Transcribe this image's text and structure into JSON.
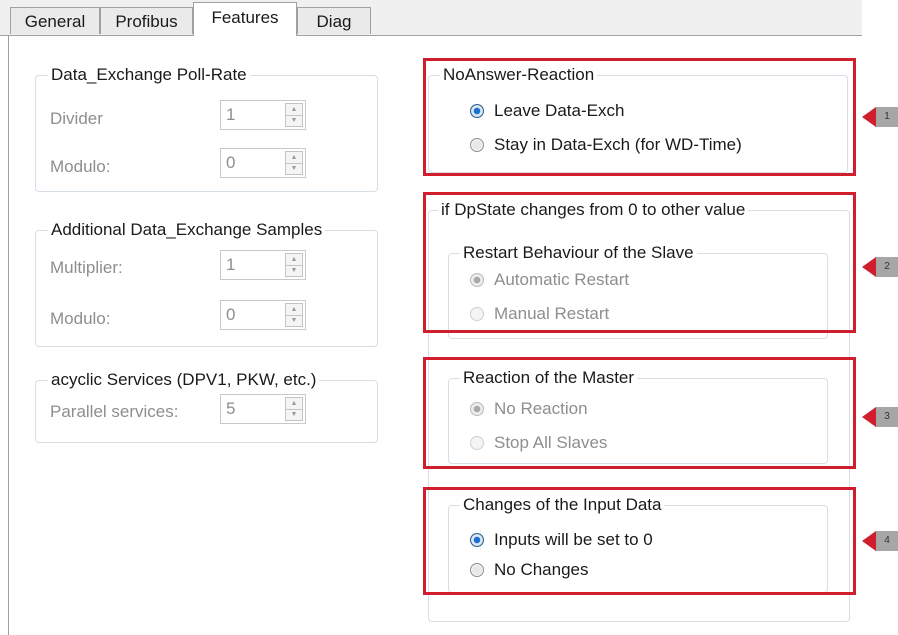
{
  "tabs": [
    "General",
    "Profibus",
    "Features",
    "Diag"
  ],
  "poll_rate": {
    "title": "Data_Exchange Poll-Rate",
    "divider_label": "Divider",
    "divider_value": "1",
    "modulo_label": "Modulo:",
    "modulo_value": "0"
  },
  "additional_samples": {
    "title": "Additional Data_Exchange Samples",
    "multiplier_label": "Multiplier:",
    "multiplier_value": "1",
    "modulo_label": "Modulo:",
    "modulo_value": "0"
  },
  "acyclic": {
    "title": "acyclic Services (DPV1, PKW, etc.)",
    "parallel_label": "Parallel services:",
    "parallel_value": "5"
  },
  "no_answer": {
    "title": "NoAnswer-Reaction",
    "options": [
      "Leave Data-Exch",
      "Stay in Data-Exch (for WD-Time)"
    ],
    "selected": "Leave Data-Exch"
  },
  "dpstate": {
    "title": "if DpState changes from 0 to other value",
    "restart": {
      "title": "Restart Behaviour of the Slave",
      "options": [
        "Automatic Restart",
        "Manual Restart"
      ],
      "selected": "Automatic Restart"
    },
    "master": {
      "title": "Reaction of the Master",
      "options": [
        "No Reaction",
        "Stop All Slaves"
      ],
      "selected": "No Reaction"
    },
    "inputs": {
      "title": "Changes of the Input Data",
      "options": [
        "Inputs will be set to 0",
        "No Changes"
      ],
      "selected": "Inputs will be set to 0"
    }
  },
  "markers": [
    "1",
    "2",
    "3",
    "4"
  ],
  "colors": {
    "highlight": "#d01e2e",
    "marker_box": "#a6a6a6",
    "group_border": "#d5dfe5"
  }
}
